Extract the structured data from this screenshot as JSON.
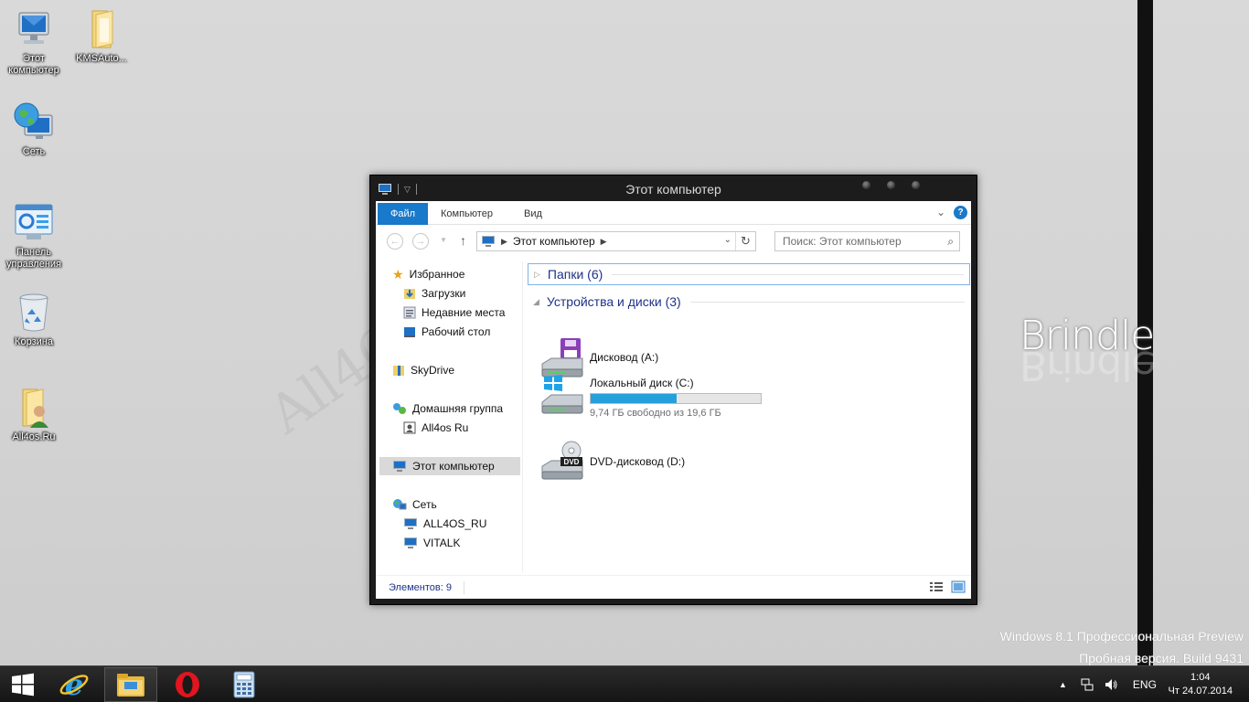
{
  "desktop": {
    "icons": [
      {
        "label": "Этот компьютер",
        "icon": "computer-icon"
      },
      {
        "label": "KMSAuto...",
        "icon": "folder-icon"
      },
      {
        "label": "Сеть",
        "icon": "network-globe-icon"
      },
      {
        "label": "Панель управления",
        "icon": "control-panel-icon"
      },
      {
        "label": "Корзина",
        "icon": "recycle-bin-icon"
      },
      {
        "label": "All4os.Ru",
        "icon": "user-folder-icon"
      }
    ],
    "watermark": "All4OS.RU",
    "brand": "Brindle",
    "os_line1": "Windows 8.1 Профессиональная Preview",
    "os_line2": "Пробная версия. Build 9431"
  },
  "window": {
    "title": "Этот компьютер",
    "ribbon": {
      "file_tab": "Файл",
      "tabs": [
        "Компьютер",
        "Вид"
      ],
      "help": "?"
    },
    "address": {
      "path": "Этот компьютер",
      "search_placeholder": "Поиск: Этот компьютер"
    },
    "nav_pane": {
      "favorites": "Избранное",
      "downloads": "Загрузки",
      "recent": "Недавние места",
      "desktop": "Рабочий стол",
      "skydrive": "SkyDrive",
      "homegroup": "Домашняя группа",
      "homegroup_user": "All4os Ru",
      "this_pc": "Этот компьютер",
      "network": "Сеть",
      "net_pc1": "ALL4OS_RU",
      "net_pc2": "VITALK"
    },
    "content": {
      "folders_group": "Папки (6)",
      "devices_group": "Устройства и диски (3)",
      "drives": [
        {
          "name": "Дисковод (A:)",
          "icon": "floppy-drive-icon"
        },
        {
          "name": "Локальный диск (C:)",
          "icon": "windows-drive-icon",
          "free_text": "9,74 ГБ свободно из 19,6 ГБ",
          "used_fraction": 0.503
        },
        {
          "name": "DVD-дисковод (D:)",
          "icon": "dvd-drive-icon",
          "badge": "DVD"
        }
      ]
    },
    "status": {
      "count": "Элементов: 9"
    }
  },
  "taskbar": {
    "apps": [
      {
        "icon": "start-windows-icon"
      },
      {
        "icon": "internet-explorer-icon"
      },
      {
        "icon": "file-explorer-icon",
        "active": true
      },
      {
        "icon": "opera-icon"
      },
      {
        "icon": "calculator-icon"
      }
    ],
    "lang": "ENG",
    "time": "1:04",
    "date": "Чт 24.07.2014",
    "accent": "#1979ca",
    "progress_color": "#26a0da"
  }
}
